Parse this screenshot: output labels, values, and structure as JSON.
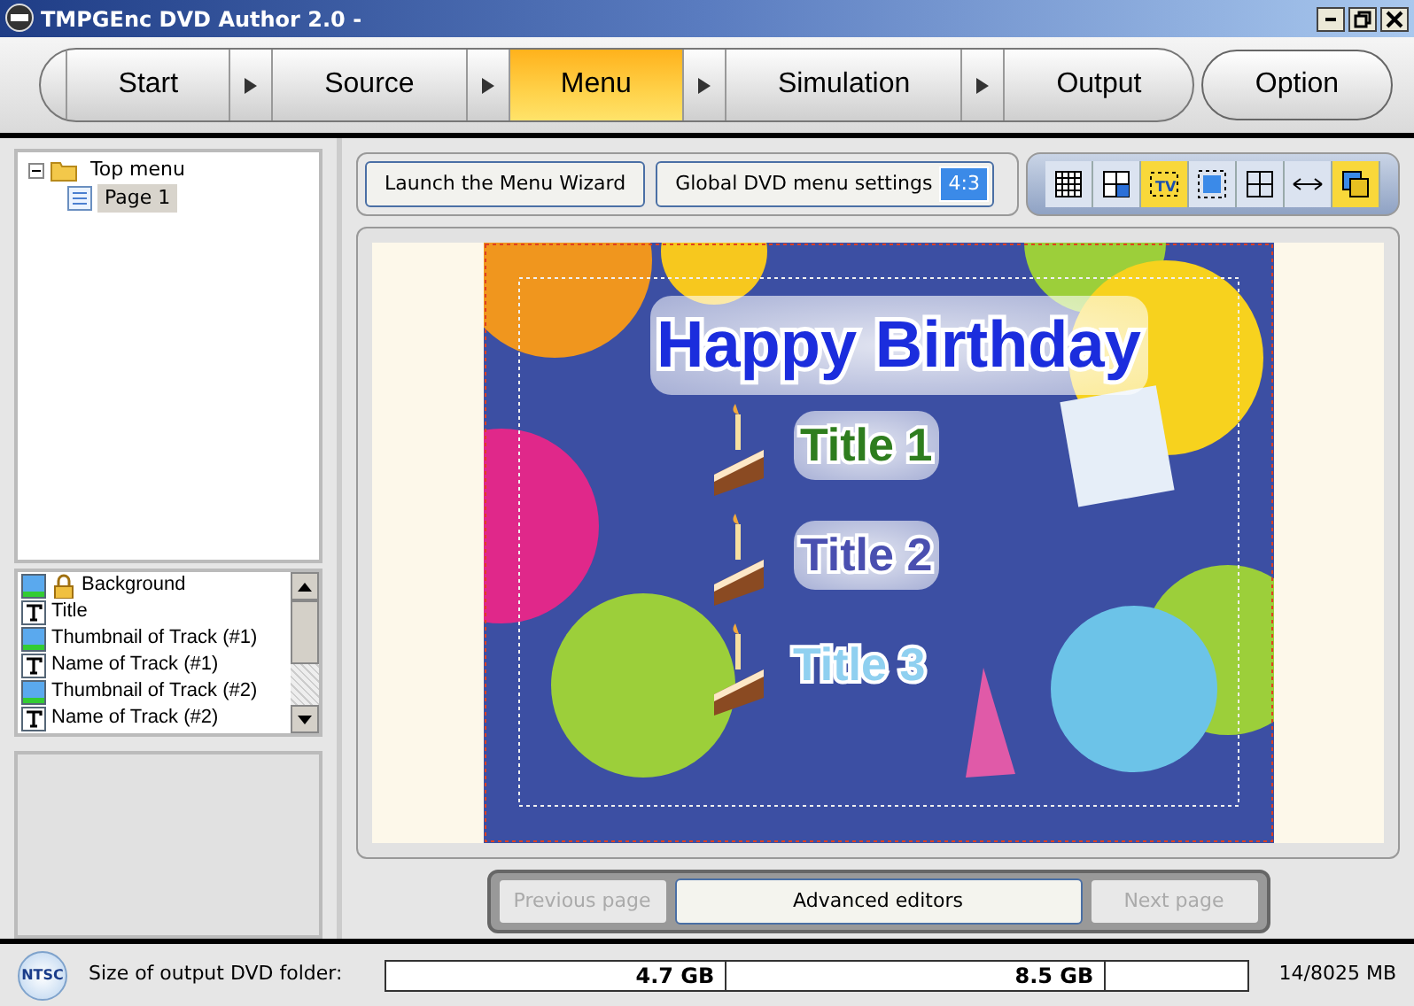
{
  "window": {
    "title": "TMPGEnc DVD Author 2.0 -"
  },
  "steps": [
    {
      "label": "Start",
      "selected": false
    },
    {
      "label": "Source",
      "selected": false
    },
    {
      "label": "Menu",
      "selected": true
    },
    {
      "label": "Simulation",
      "selected": false
    },
    {
      "label": "Output",
      "selected": false
    }
  ],
  "option_button": "Option",
  "tree": [
    {
      "label": "Top menu",
      "expanded": true,
      "selected": false,
      "children": [
        {
          "label": "Page 1",
          "selected": true
        }
      ]
    }
  ],
  "layers": [
    {
      "kind": "image",
      "label": "Background",
      "locked": true
    },
    {
      "kind": "text",
      "label": "Title",
      "locked": false
    },
    {
      "kind": "image",
      "label": "Thumbnail of Track (#1)",
      "locked": false
    },
    {
      "kind": "text",
      "label": "Name of Track (#1)",
      "locked": false
    },
    {
      "kind": "image",
      "label": "Thumbnail of Track (#2)",
      "locked": false
    },
    {
      "kind": "text",
      "label": "Name of Track (#2)",
      "locked": false
    }
  ],
  "toolbar": {
    "wizard_button": "Launch the Menu Wizard",
    "settings_button": "Global DVD menu settings",
    "aspect": "4:3"
  },
  "tools": [
    {
      "kind": "grid",
      "selected": false
    },
    {
      "kind": "quarter",
      "selected": false
    },
    {
      "kind": "tv",
      "selected": true,
      "label": "TV"
    },
    {
      "kind": "frame",
      "selected": false
    },
    {
      "kind": "cross",
      "selected": false
    },
    {
      "kind": "arrows",
      "selected": false
    },
    {
      "kind": "overlap",
      "selected": true
    }
  ],
  "preview": {
    "title": "Happy Birthday",
    "items": [
      {
        "label": "Title 1",
        "color": "#2e7d1e"
      },
      {
        "label": "Title 2",
        "color": "#4a4fb0"
      },
      {
        "label": "Title 3",
        "color": "#8fd0f0"
      }
    ]
  },
  "page_buttons": [
    {
      "label": "Previous page",
      "disabled": true
    },
    {
      "label": "Advanced editors",
      "disabled": false
    },
    {
      "label": "Next page",
      "disabled": true
    }
  ],
  "status_bar": {
    "standard": "NTSC",
    "label": "Size of output DVD folder:",
    "marks": [
      "4.7 GB",
      "8.5 GB"
    ],
    "usage": "14/8025 MB"
  }
}
